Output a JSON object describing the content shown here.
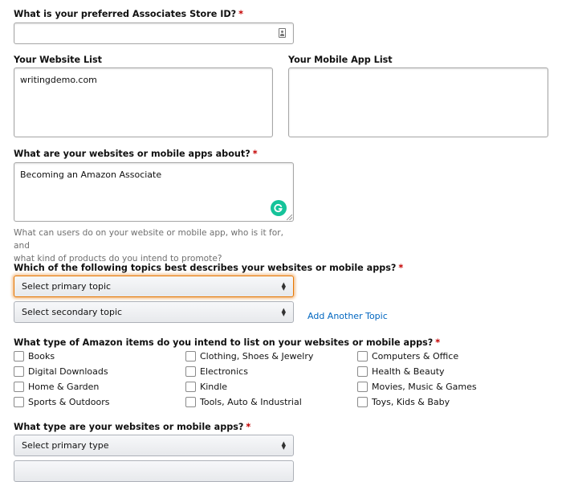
{
  "store_id": {
    "label": "What is your preferred Associates Store ID?",
    "required_mark": "*",
    "value": "",
    "icon": "contact-card-icon"
  },
  "website_list": {
    "label": "Your Website List",
    "value": "writingdemo.com"
  },
  "mobile_app_list": {
    "label": "Your Mobile App List",
    "value": ""
  },
  "about": {
    "label": "What are your websites or mobile apps about?",
    "required_mark": "*",
    "value": "Becoming an Amazon Associate",
    "hint_line1": "What can users do on your website or mobile app, who is it for, and",
    "hint_line2": "what kind of products do you intend to promote?",
    "grammarly_color": "#15c39a"
  },
  "topics": {
    "label": "Which of the following topics best describes your websites or mobile apps?",
    "required_mark": "*",
    "primary": "Select primary topic",
    "secondary": "Select secondary topic",
    "add_link": "Add Another Topic"
  },
  "items": {
    "label": "What type of Amazon items do you intend to list on your websites or mobile apps?",
    "required_mark": "*",
    "options": [
      "Books",
      "Clothing, Shoes & Jewelry",
      "Computers & Office",
      "Digital Downloads",
      "Electronics",
      "Health & Beauty",
      "Home & Garden",
      "Kindle",
      "Movies, Music & Games",
      "Sports & Outdoors",
      "Tools, Auto & Industrial",
      "Toys, Kids & Baby"
    ]
  },
  "site_type": {
    "label": "What type are your websites or mobile apps?",
    "required_mark": "*",
    "primary": "Select primary type"
  },
  "colors": {
    "focus": "#e77600",
    "link": "#0066c0",
    "required": "#c40000"
  }
}
